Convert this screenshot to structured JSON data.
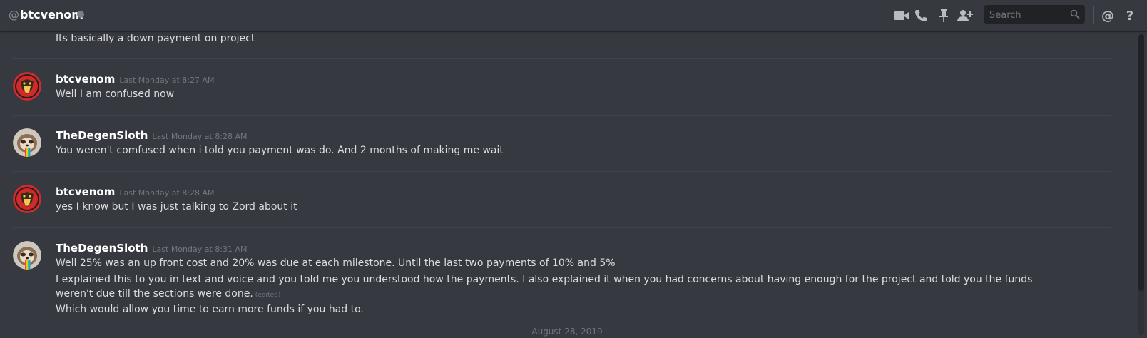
{
  "header": {
    "at_symbol": "@",
    "title": "btcvenom",
    "status_color": "#747f8d",
    "icons": [
      "video-call-icon",
      "voice-call-icon",
      "pin-icon",
      "add-friend-icon",
      "mentions-icon",
      "help-icon"
    ],
    "mentions_glyph": "@",
    "help_glyph": "?"
  },
  "search": {
    "placeholder": "Search"
  },
  "messages": [
    {
      "continuation": true,
      "lines": [
        "Its basically a down payment on project"
      ]
    },
    {
      "author": "btcvenom",
      "timestamp": "Last Monday at 8:27 AM",
      "lines": [
        "Well I am confused now"
      ]
    },
    {
      "author": "TheDegenSloth",
      "timestamp": "Last Monday at 8:28 AM",
      "lines": [
        "You weren't comfused when i told you payment was do. And 2 months of making me wait"
      ]
    },
    {
      "author": "btcvenom",
      "timestamp": "Last Monday at 8:28 AM",
      "lines": [
        "yes I know but I was just talking to Zord about it"
      ]
    },
    {
      "author": "TheDegenSloth",
      "timestamp": "Last Monday at 8:31 AM",
      "lines": [
        "Well 25% was an up front cost and 20% was due at each milestone. Until the last two payments of 10% and 5%",
        "I explained this to you in text and voice and you told me you understood how the payments. I also explained it when you had concerns about having enough for the project and told you the funds weren't due till the sections were done.",
        "Which would allow you time to earn more funds if you had to."
      ],
      "edited_label": "(edited)"
    }
  ],
  "date_divider": "August 28, 2019",
  "colors": {
    "background": "#36393f",
    "text": "#dcddde",
    "muted": "#72767d",
    "username": "#ffffff",
    "search_bg": "#202225"
  }
}
